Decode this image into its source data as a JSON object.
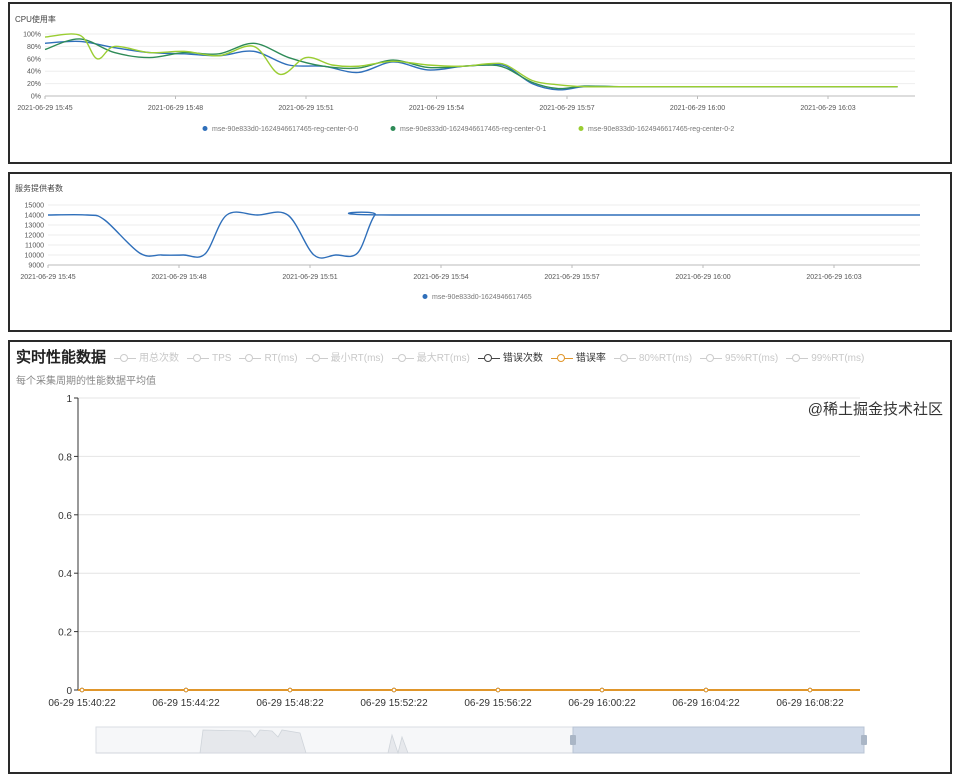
{
  "chart_data": [
    {
      "type": "line",
      "title": "CPU使用率",
      "y_ticks": [
        "100%",
        "80%",
        "60%",
        "40%",
        "20%",
        "0%"
      ],
      "ylim": [
        0,
        100
      ],
      "x_ticks": [
        "2021-06-29 15:45",
        "2021-06-29 15:48",
        "2021-06-29 15:51",
        "2021-06-29 15:54",
        "2021-06-29 15:57",
        "2021-06-29 16:00",
        "2021-06-29 16:03"
      ],
      "x_minutes": [
        0,
        20
      ],
      "legend_position": "bottom",
      "series": [
        {
          "name": "mse-90e833d0-1624946617465-reg-center-0-0",
          "color": "#2f6fba",
          "x": [
            0,
            0.8,
            1.6,
            2.4,
            3.2,
            4.0,
            4.8,
            5.6,
            6.4,
            7.2,
            8.0,
            8.8,
            9.6,
            10.2,
            10.6,
            11.2,
            11.8,
            12.4,
            13.2,
            14.0,
            14.8,
            15.6,
            16.4,
            17.2,
            18.0,
            18.8,
            19.6
          ],
          "y": [
            85,
            88,
            78,
            70,
            68,
            65,
            72,
            50,
            48,
            38,
            55,
            42,
            48,
            50,
            48,
            20,
            10,
            15,
            15,
            15,
            15,
            15,
            15,
            15,
            15,
            15,
            15
          ]
        },
        {
          "name": "mse-90e833d0-1624946617465-reg-center-0-1",
          "color": "#2e8b57",
          "x": [
            0,
            0.8,
            1.6,
            2.4,
            3.2,
            4.0,
            4.8,
            5.6,
            6.4,
            7.2,
            8.0,
            8.8,
            9.6,
            10.2,
            10.6,
            11.2,
            11.8,
            12.4,
            13.2,
            14.0,
            14.8,
            15.6,
            16.4,
            17.2,
            18.0,
            18.8,
            19.6
          ],
          "y": [
            75,
            92,
            70,
            62,
            70,
            68,
            85,
            62,
            48,
            45,
            58,
            46,
            48,
            50,
            45,
            22,
            12,
            16,
            15,
            15,
            15,
            15,
            15,
            15,
            15,
            15,
            15
          ]
        },
        {
          "name": "mse-90e833d0-1624946617465-reg-center-0-2",
          "color": "#9acd32",
          "x": [
            0,
            0.8,
            1.2,
            1.6,
            2.4,
            3.2,
            4.0,
            4.8,
            5.4,
            6.0,
            6.6,
            7.2,
            8.0,
            8.8,
            9.6,
            10.2,
            10.6,
            11.2,
            11.8,
            12.4,
            13.2,
            14.0,
            14.8,
            15.6,
            16.4,
            17.2,
            18.0,
            18.8,
            19.6
          ],
          "y": [
            95,
            98,
            60,
            80,
            70,
            72,
            65,
            80,
            35,
            62,
            50,
            48,
            56,
            50,
            48,
            52,
            50,
            25,
            18,
            15,
            15,
            15,
            15,
            15,
            15,
            15,
            15,
            15,
            15
          ]
        }
      ]
    },
    {
      "type": "line",
      "title": "服务提供者数",
      "y_ticks": [
        "15000",
        "14000",
        "13000",
        "12000",
        "11000",
        "10000",
        "9000"
      ],
      "ylim": [
        9000,
        15000
      ],
      "x_ticks": [
        "2021-06-29 15:45",
        "2021-06-29 15:48",
        "2021-06-29 15:51",
        "2021-06-29 15:54",
        "2021-06-29 15:57",
        "2021-06-29 16:00",
        "2021-06-29 16:03"
      ],
      "x_minutes": [
        0,
        20
      ],
      "legend_position": "bottom",
      "series": [
        {
          "name": "mse-90e833d0-1624946617465",
          "color": "#2f6fba",
          "x": [
            0,
            0.9,
            1.3,
            2.1,
            2.6,
            3.1,
            3.6,
            4.1,
            4.8,
            5.5,
            6.1,
            6.6,
            7.1,
            7.5,
            7.9,
            20
          ],
          "y": [
            14000,
            14000,
            13500,
            10200,
            10000,
            10000,
            10100,
            14000,
            14000,
            14000,
            10000,
            10000,
            10200,
            14000,
            14000,
            14000
          ]
        }
      ]
    },
    {
      "type": "line",
      "title": "实时性能数据",
      "subtitle": "每个采集周期的性能数据平均值",
      "y_ticks": [
        "1",
        "0.8",
        "0.6",
        "0.4",
        "0.2",
        "0"
      ],
      "ylim": [
        0,
        1
      ],
      "x_ticks": [
        "06-29 15:40:22",
        "06-29 15:44:22",
        "06-29 15:48:22",
        "06-29 15:52:22",
        "06-29 15:56:22",
        "06-29 16:00:22",
        "06-29 16:04:22",
        "06-29 16:08:22"
      ],
      "legend_items": [
        {
          "label": "用总次数",
          "active": false
        },
        {
          "label": "TPS",
          "active": false
        },
        {
          "label": "RT(ms)",
          "active": false
        },
        {
          "label": "最小RT(ms)",
          "active": false
        },
        {
          "label": "最大RT(ms)",
          "active": false
        },
        {
          "label": "错误次数",
          "active": true,
          "kind": "err"
        },
        {
          "label": "错误率",
          "active": true,
          "kind": "rate"
        },
        {
          "label": "80%RT(ms)",
          "active": false
        },
        {
          "label": "95%RT(ms)",
          "active": false
        },
        {
          "label": "99%RT(ms)",
          "active": false
        }
      ],
      "series": [
        {
          "name": "错误次数",
          "color": "#444444",
          "values": [
            0,
            0,
            0,
            0,
            0,
            0,
            0,
            0
          ]
        },
        {
          "name": "错误率",
          "color": "#e0962b",
          "values": [
            0,
            0,
            0,
            0,
            0,
            0,
            0,
            0
          ]
        }
      ]
    }
  ],
  "watermark": "@稀土掘金技术社区"
}
